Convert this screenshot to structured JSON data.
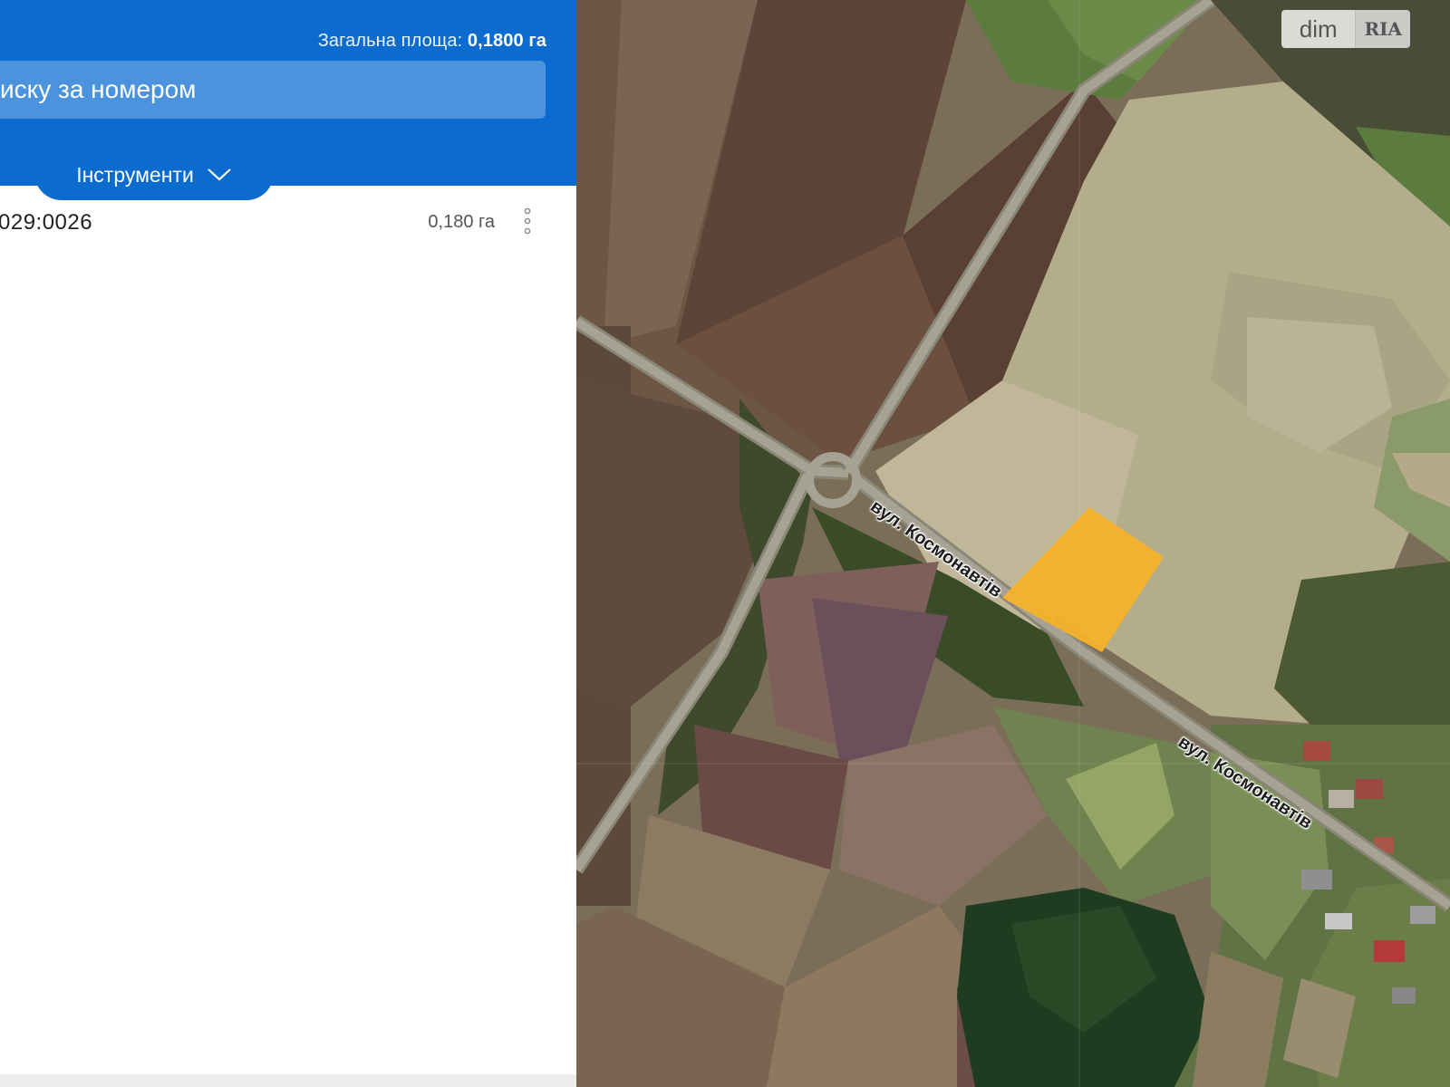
{
  "panel": {
    "total_area_label": "Загальна площа:",
    "total_area_value": "0,1800 га",
    "search_placeholder": "иску за номером",
    "tools_label": "Інструменти",
    "parcel": {
      "number": "029:0026",
      "area": "0,180 га"
    }
  },
  "map": {
    "street_label_1": "вул. Космонавтів",
    "street_label_2": "вул. Космонавтів",
    "parcel_color": "#f5b22a",
    "logo_left": "dim",
    "logo_right": "RIA"
  },
  "colors": {
    "header_blue": "#0b6bcf",
    "search_blue": "#4c93de"
  },
  "icons": [
    "chevron-down-icon",
    "more-vertical-icon"
  ]
}
